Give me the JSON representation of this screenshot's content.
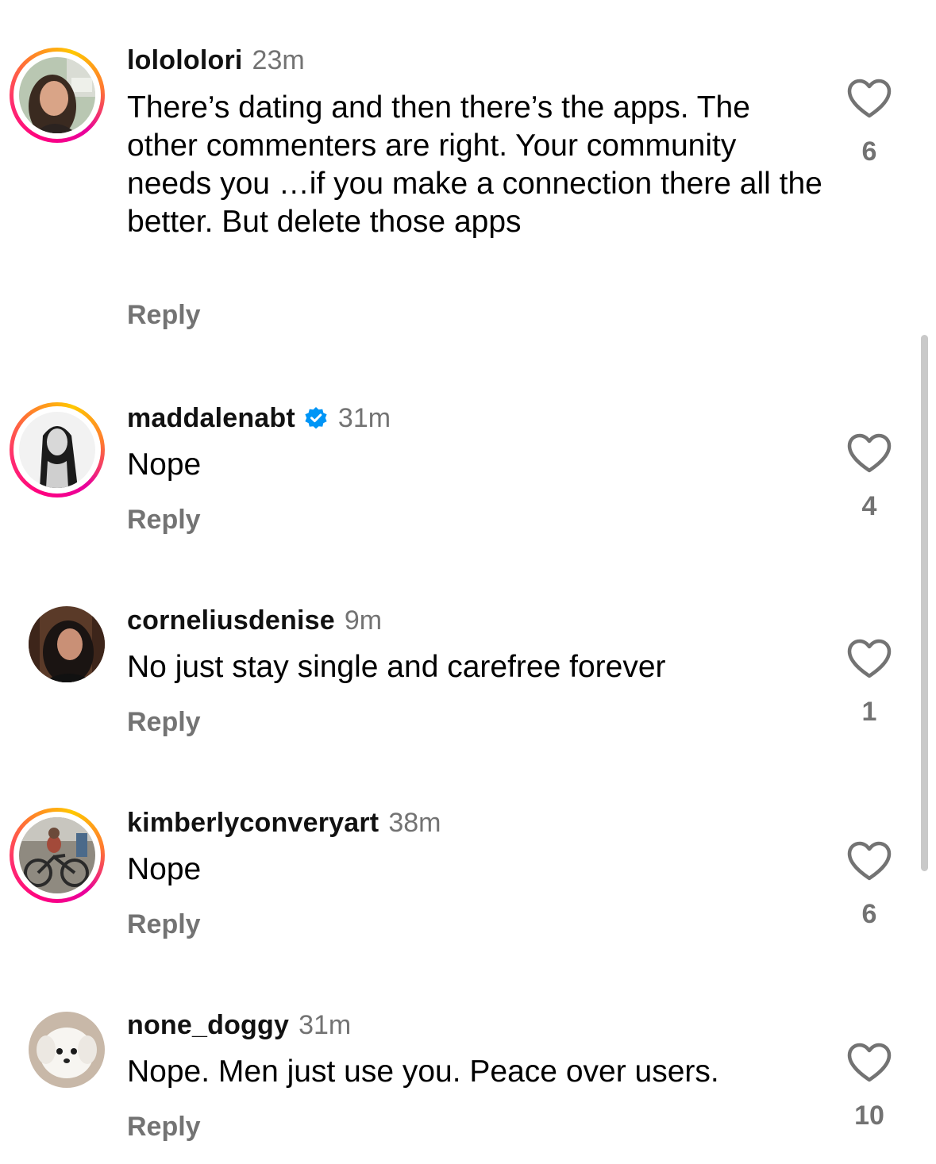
{
  "comments": [
    {
      "username": "lolololori",
      "time": "23m",
      "verified": false,
      "text": "There’s dating and then there’s the apps. The other commenters are right. Your community needs you …if you make a connection there all the better. But delete those apps",
      "reply_label": "Reply",
      "likes": "6",
      "avatar_ring": true
    },
    {
      "username": "maddalenabt",
      "time": "31m",
      "verified": true,
      "text": "Nope",
      "reply_label": "Reply",
      "likes": "4",
      "avatar_ring": true
    },
    {
      "username": "corneliusdenise",
      "time": "9m",
      "verified": false,
      "text": "No just stay single and carefree forever",
      "reply_label": "Reply",
      "likes": "1",
      "avatar_ring": false
    },
    {
      "username": "kimberlyconveryart",
      "time": "38m",
      "verified": false,
      "text": "Nope",
      "reply_label": "Reply",
      "likes": "6",
      "avatar_ring": true
    },
    {
      "username": "none_doggy",
      "time": "31m",
      "verified": false,
      "text": "Nope. Men just use you. Peace over users.",
      "reply_label": "Reply",
      "likes": "10",
      "avatar_ring": false
    }
  ],
  "colors": {
    "verified_blue": "#0095f6",
    "secondary_text": "#737373",
    "story_ring": "#ff0080"
  },
  "icons": {
    "like": "heart-outline-icon",
    "verified": "verified-badge-icon"
  }
}
